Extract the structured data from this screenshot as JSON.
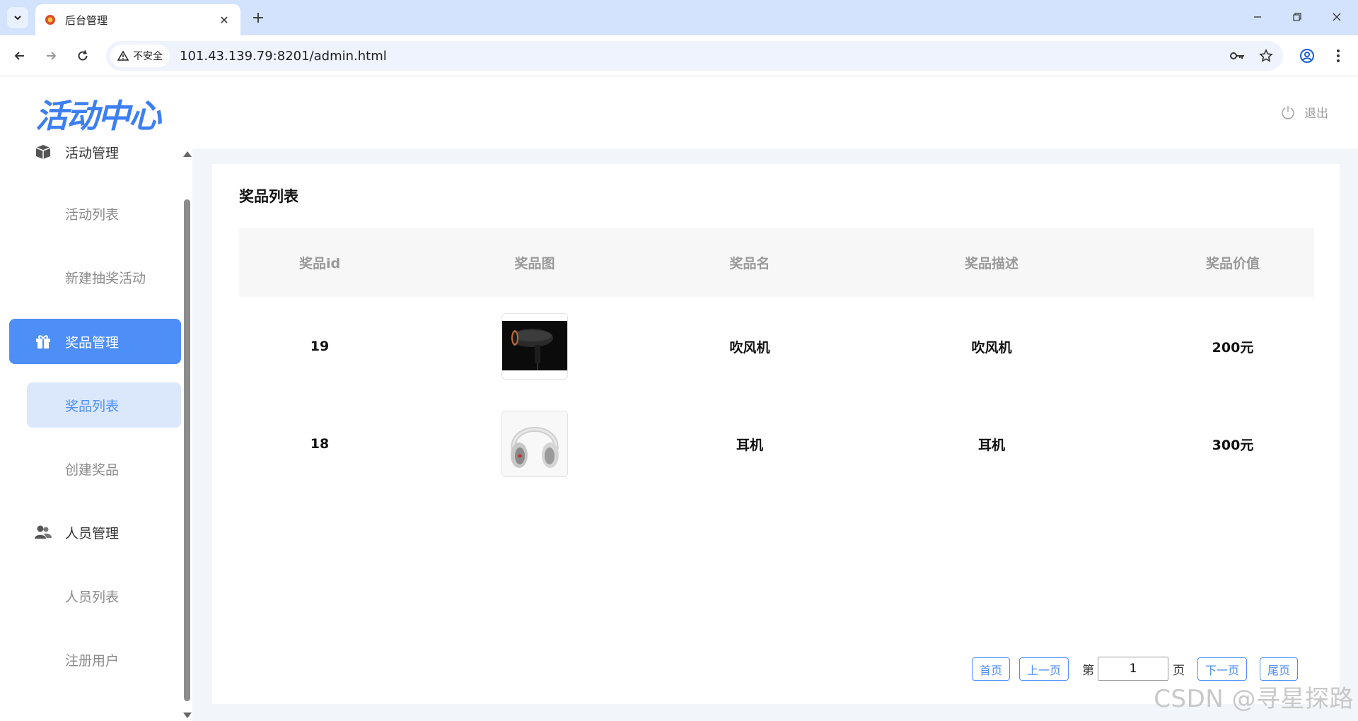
{
  "browser": {
    "tab_title": "后台管理",
    "security_label": "不安全",
    "url": "101.43.139.79:8201/admin.html"
  },
  "header": {
    "logo": "活动中心",
    "logout": "退出"
  },
  "sidebar": {
    "items": [
      {
        "label": "活动管理",
        "icon": "cube-icon",
        "type": "group"
      },
      {
        "label": "活动列表",
        "type": "sub"
      },
      {
        "label": "新建抽奖活动",
        "type": "sub"
      },
      {
        "label": "奖品管理",
        "icon": "gift-icon",
        "type": "group",
        "active": true
      },
      {
        "label": "奖品列表",
        "type": "sub",
        "active": true
      },
      {
        "label": "创建奖品",
        "type": "sub"
      },
      {
        "label": "人员管理",
        "icon": "users-icon",
        "type": "group"
      },
      {
        "label": "人员列表",
        "type": "sub"
      },
      {
        "label": "注册用户",
        "type": "sub"
      }
    ]
  },
  "main": {
    "title": "奖品列表",
    "columns": [
      "奖品id",
      "奖品图",
      "奖品名",
      "奖品描述",
      "奖品价值"
    ],
    "rows": [
      {
        "id": "19",
        "image": "hair-dryer-image",
        "name": "吹风机",
        "description": "吹风机",
        "value": "200元"
      },
      {
        "id": "18",
        "image": "headphones-image",
        "name": "耳机",
        "description": "耳机",
        "value": "300元"
      }
    ]
  },
  "pagination": {
    "first": "首页",
    "prev": "上一页",
    "page_prefix": "第",
    "current_page": "1",
    "page_suffix": "页",
    "next": "下一页",
    "last": "尾页"
  },
  "watermark": "CSDN @寻星探路",
  "colors": {
    "accent": "#4d8ef7",
    "tabbar": "#d3e3fd",
    "logo": "#3d7ff2"
  }
}
